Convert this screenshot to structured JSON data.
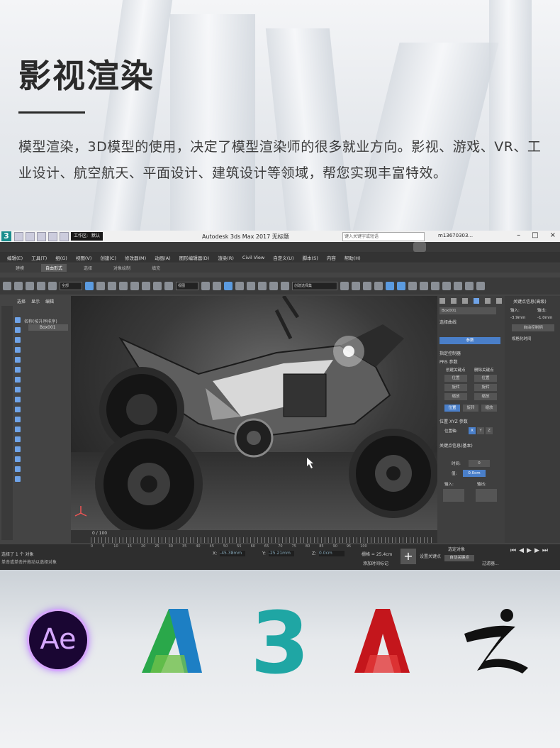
{
  "hero": {
    "title": "影视渲染",
    "description": "模型渲染，3D模型的使用，决定了模型渲染师的很多就业方向。影视、游戏、VR、工业设计、航空航天、平面设计、建筑设计等领域，帮您实现丰富特效。"
  },
  "app": {
    "window_title": "Autodesk 3ds Max 2017   无标题",
    "workspace_items": [
      "工作区:",
      "默认"
    ],
    "search_placeholder": "键入关键字或短语",
    "user": "m13670303...",
    "menu": [
      "编辑(E)",
      "工具(T)",
      "组(G)",
      "视图(V)",
      "创建(C)",
      "修改器(M)",
      "动画(A)",
      "图形编辑器(D)",
      "渲染(R)",
      "Civil View",
      "自定义(U)",
      "脚本(S)",
      "内容",
      "帮助(H)"
    ],
    "ribbon_tabs": [
      "建模",
      "自由形式",
      "选择",
      "对象绘制",
      "填充"
    ],
    "ribbon_active": "自由形式",
    "selection_dropdown": "全部",
    "view_dropdown": "视图",
    "selection_set": "创建选择集",
    "scene_tabs": [
      "选择",
      "显示",
      "编辑"
    ],
    "scene_header": "名称(按升序排序)",
    "scene_object": "Box001",
    "timeline_frame": "0 / 100",
    "timeline_ticks": [
      "0",
      "5",
      "10",
      "15",
      "20",
      "25",
      "30",
      "35",
      "40",
      "45",
      "50",
      "55",
      "60",
      "65",
      "70",
      "75",
      "80",
      "85",
      "90",
      "95",
      "100"
    ],
    "status_selected": "选择了 1 个 对象",
    "status_hint": "单击或单击并拖动以选择对象",
    "coords": {
      "x": "-45.38mm",
      "y": "-25.21mm",
      "z": "0.0cm"
    },
    "grid": "栅格 = 25.4cm",
    "add_time_tag": "添加时间标记",
    "auto_key": "自动关键点",
    "set_key": "设置关键点",
    "key_filter": "过滤器...",
    "selected_obj": "选定对象",
    "right_panel": {
      "object_name": "Box001",
      "pivot": "选择曲线",
      "buttons": [
        "参数"
      ],
      "sections": [
        "指定控制器",
        "PRS 参数",
        "位置 XYZ 参数",
        "关键点信息(基本)"
      ],
      "create_key": "创建关键点",
      "delete_key": "删除关键点",
      "prs_buttons": [
        "位置",
        "旋转",
        "缩放"
      ],
      "pos_rot_scale": [
        "位置",
        "旋转",
        "缩放"
      ],
      "axis_label": "位置轴:",
      "axes": [
        "X",
        "Y",
        "Z"
      ],
      "key_time_label": "时间:",
      "key_time": "0",
      "key_value_label": "值:",
      "key_value": "0.0cm",
      "in_label": "输入:",
      "out_label": "输出:",
      "far_title": "关键点信息(高级)",
      "far_labels": [
        "输入:",
        "输出:"
      ],
      "far_values": [
        "-3.9mm",
        "-1.0mm"
      ],
      "free_handle": "自由控制柄",
      "normalize": "规格化时间"
    }
  },
  "logos": [
    "Ae",
    "Autodesk",
    "3",
    "A",
    "ZBrush"
  ],
  "colors": {
    "ae_bg": "#1a0633",
    "ae_fg": "#d6a8ff",
    "max_teal": "#1a8d8d",
    "autocad_red": "#c4161c"
  }
}
